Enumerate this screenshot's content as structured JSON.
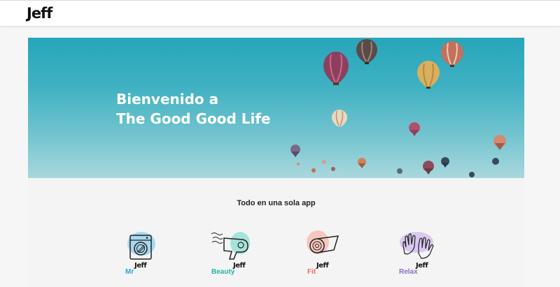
{
  "header": {
    "logo": "Jeff"
  },
  "hero": {
    "line1": "Bienvenido a",
    "line2": "The Good Good Life"
  },
  "apps_section": {
    "title": "Todo en una sola app",
    "apps": [
      {
        "label": "Mr",
        "brand": "Jeff",
        "color": "#2aa6d8",
        "icon": "washing-machine-icon"
      },
      {
        "label": "Beauty",
        "brand": "Jeff",
        "color": "#27b3a6",
        "icon": "hair-dryer-icon"
      },
      {
        "label": "Fit",
        "brand": "Jeff",
        "color": "#ef6b5a",
        "icon": "yoga-mat-icon"
      },
      {
        "label": "Relax",
        "brand": "Jeff",
        "color": "#8b6fc7",
        "icon": "massage-hands-icon"
      }
    ]
  }
}
